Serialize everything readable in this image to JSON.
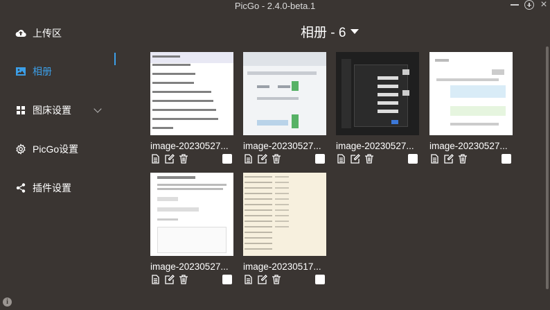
{
  "window": {
    "title": "PicGo - 2.4.0-beta.1"
  },
  "sidebar": {
    "items": [
      {
        "label": "上传区",
        "icon": "cloud-upload-icon"
      },
      {
        "label": "相册",
        "icon": "image-icon",
        "active": true
      },
      {
        "label": "图床设置",
        "icon": "grid-icon"
      },
      {
        "label": "PicGo设置",
        "icon": "gear-icon"
      },
      {
        "label": "插件设置",
        "icon": "share-icon"
      }
    ]
  },
  "gallery": {
    "title": "相册 - 6",
    "images": [
      {
        "name": "image-20230527..."
      },
      {
        "name": "image-20230527..."
      },
      {
        "name": "image-20230527..."
      },
      {
        "name": "image-20230527..."
      },
      {
        "name": "image-20230527..."
      },
      {
        "name": "image-20230517..."
      }
    ]
  },
  "colors": {
    "background": "#3a3532",
    "accent": "#3c9fe8"
  }
}
